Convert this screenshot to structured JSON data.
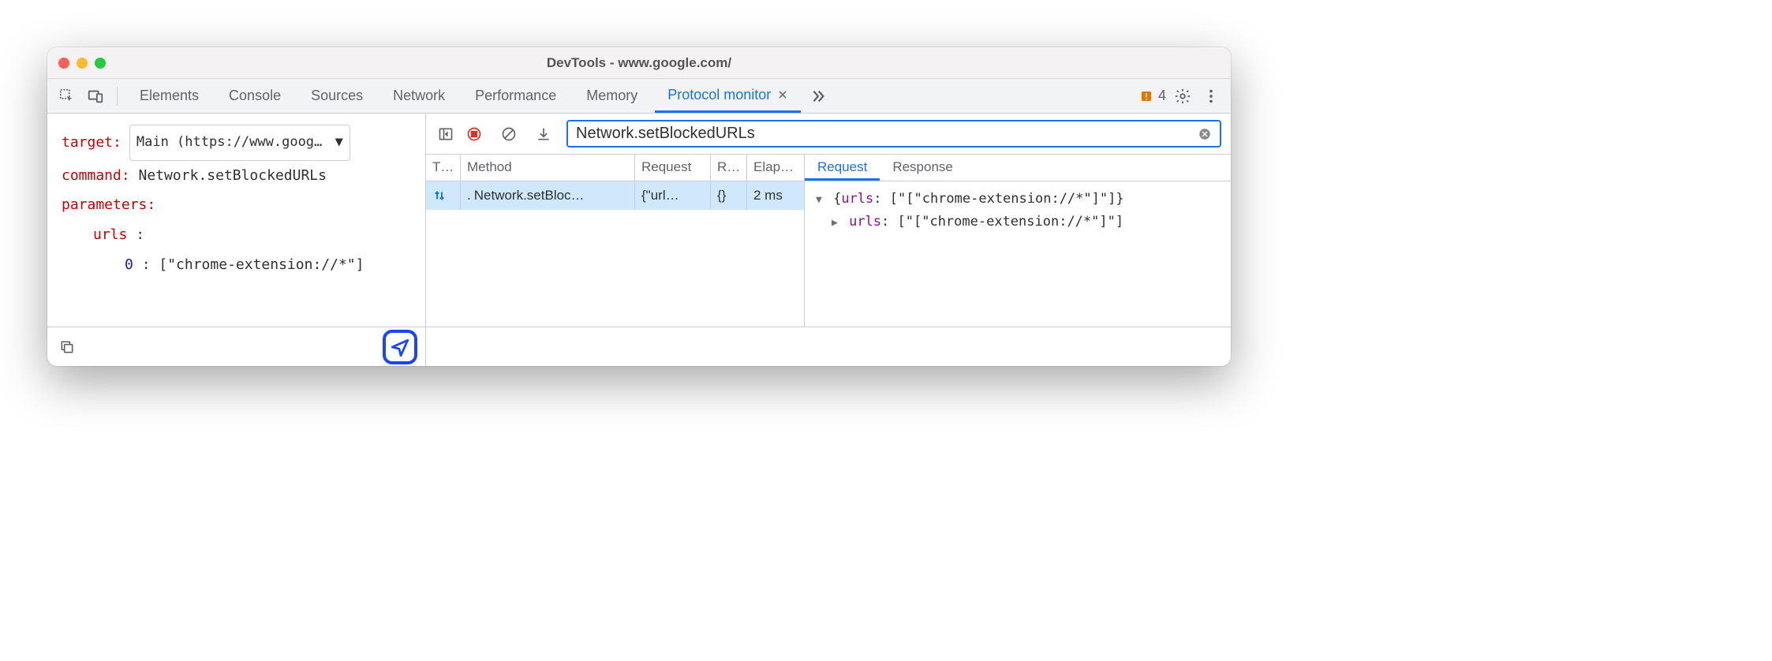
{
  "window": {
    "title": "DevTools - www.google.com/"
  },
  "tabs": {
    "items": [
      "Elements",
      "Console",
      "Sources",
      "Network",
      "Performance",
      "Memory"
    ],
    "active": "Protocol monitor"
  },
  "warnings": {
    "count": "4"
  },
  "editor": {
    "target_label": "target",
    "target_value": "Main (https://www.goog…",
    "command_label": "command",
    "command_value": "Network.setBlockedURLs",
    "params_label": "parameters",
    "urls_key": "urls",
    "urls_colon": ":",
    "idx0": "0",
    "idx0_val": "[\"chrome-extension://*\"]"
  },
  "filter": {
    "value": "Network.setBlockedURLs"
  },
  "table": {
    "columns": {
      "type": "T…",
      "method": "Method",
      "request": "Request",
      "r": "R…",
      "elapsed": "Elap…"
    },
    "rows": [
      {
        "method": "Network.setBloc…",
        "request": "{\"url…",
        "r": "{}",
        "elapsed": "2 ms"
      }
    ]
  },
  "detail": {
    "tabs": {
      "request": "Request",
      "response": "Response"
    },
    "line1_prefix": "{",
    "line1_key": "urls",
    "line1_val": "[\"[\"chrome-extension://*\"]\"]}",
    "line2_key": "urls",
    "line2_val": "[\"[\"chrome-extension://*\"]\"]"
  }
}
